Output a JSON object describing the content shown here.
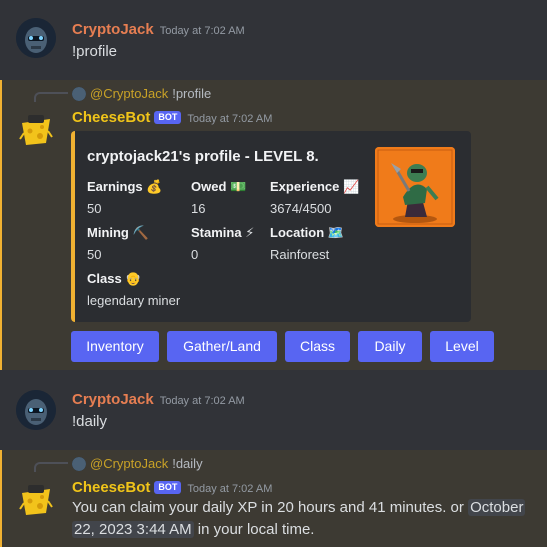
{
  "messages": {
    "m1": {
      "author": "CryptoJack",
      "time": "Today at 7:02 AM",
      "text": "!profile"
    },
    "m2": {
      "reply_author": "@CryptoJack",
      "reply_text": "!profile",
      "author": "CheeseBot",
      "bot_tag": "BOT",
      "time": "Today at 7:02 AM",
      "embed": {
        "title": "cryptojack21's profile - LEVEL 8.",
        "fields": [
          {
            "name": "Earnings",
            "emoji": "💰",
            "value": "50"
          },
          {
            "name": "Owed",
            "emoji": "💵",
            "value": "16"
          },
          {
            "name": "Experience",
            "emoji": "📈",
            "value": "3674/4500"
          },
          {
            "name": "Mining",
            "emoji": "⛏️",
            "value": "50"
          },
          {
            "name": "Stamina",
            "emoji": "⚡",
            "value": "0"
          },
          {
            "name": "Location",
            "emoji": "🗺️",
            "value": "Rainforest"
          },
          {
            "name": "Class",
            "emoji": "👴",
            "value": "legendary miner"
          }
        ]
      },
      "buttons": [
        "Inventory",
        "Gather/Land",
        "Class",
        "Daily",
        "Level"
      ]
    },
    "m3": {
      "author": "CryptoJack",
      "time": "Today at 7:02 AM",
      "text": "!daily"
    },
    "m4": {
      "reply_author": "@CryptoJack",
      "reply_text": "!daily",
      "author": "CheeseBot",
      "bot_tag": "BOT",
      "time": "Today at 7:02 AM",
      "text_1": "You can claim your daily XP in 20 hours and 41 minutes. or",
      "ts_1": "October",
      "ts_2": "22, 2023 3:44 AM",
      "text_2": "in your local time."
    }
  },
  "colors": {
    "user_name": "#e67e52",
    "bot_name": "#f0c419",
    "button": "#5865f2",
    "mention_bg": "#3d3a33",
    "accent": "#f0b132"
  }
}
